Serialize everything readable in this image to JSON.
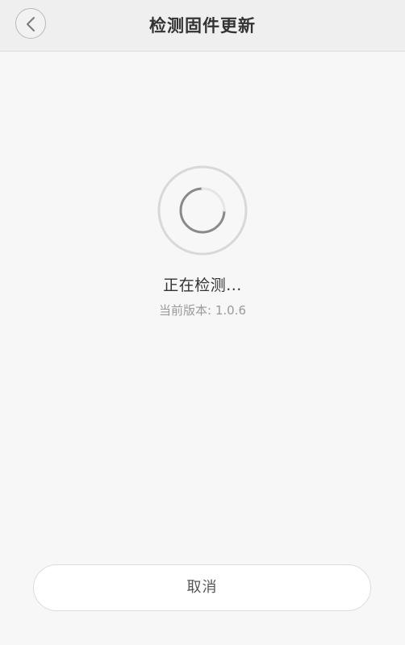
{
  "header": {
    "title": "检测固件更新",
    "back_icon": "chevron-left-icon"
  },
  "status": {
    "text": "正在检测...",
    "version_text": "当前版本: 1.0.6",
    "spinner_icon": "loading-spinner-icon"
  },
  "footer": {
    "cancel_label": "取消"
  },
  "colors": {
    "background": "#f7f7f7",
    "header_background": "#efefef",
    "title_text": "#333333",
    "secondary_text": "#9a9a9a"
  }
}
